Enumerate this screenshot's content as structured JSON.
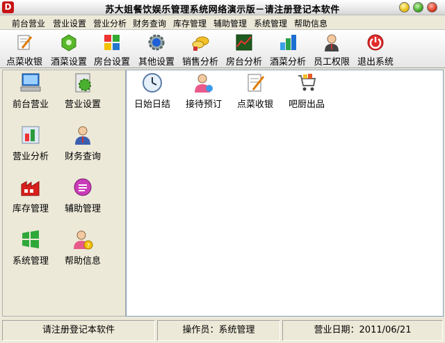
{
  "window": {
    "title": "苏大姐餐饮娱乐管理系统网络演示版－请注册登记本软件",
    "app_icon_glyph": "D"
  },
  "menu": [
    "前台营业",
    "营业设置",
    "营业分析",
    "财务查询",
    "库存管理",
    "辅助管理",
    "系统管理",
    "帮助信息"
  ],
  "toolbar": [
    {
      "label": "点菜收银",
      "icon": "order-icon"
    },
    {
      "label": "酒菜设置",
      "icon": "dish-settings-icon"
    },
    {
      "label": "房台设置",
      "icon": "table-settings-icon"
    },
    {
      "label": "其他设置",
      "icon": "other-settings-icon"
    },
    {
      "label": "销售分析",
      "icon": "sales-analysis-icon"
    },
    {
      "label": "房台分析",
      "icon": "table-analysis-icon"
    },
    {
      "label": "酒菜分析",
      "icon": "dish-analysis-icon"
    },
    {
      "label": "员工权限",
      "icon": "staff-permission-icon"
    },
    {
      "label": "退出系统",
      "icon": "exit-icon"
    }
  ],
  "sidebar": [
    {
      "label": "前台营业",
      "icon": "front-desk-icon"
    },
    {
      "label": "营业设置",
      "icon": "business-settings-icon"
    },
    {
      "label": "营业分析",
      "icon": "business-analysis-icon"
    },
    {
      "label": "财务查询",
      "icon": "finance-query-icon"
    },
    {
      "label": "库存管理",
      "icon": "inventory-icon"
    },
    {
      "label": "辅助管理",
      "icon": "auxiliary-icon"
    },
    {
      "label": "系统管理",
      "icon": "system-icon"
    },
    {
      "label": "帮助信息",
      "icon": "help-icon"
    }
  ],
  "main_items": [
    {
      "label": "日始日结",
      "icon": "clock-icon"
    },
    {
      "label": "接待预订",
      "icon": "reception-icon"
    },
    {
      "label": "点菜收银",
      "icon": "order-icon"
    },
    {
      "label": "吧厨出品",
      "icon": "kitchen-cart-icon"
    }
  ],
  "status": {
    "register": "请注册登记本软件",
    "operator": "操作员：系统管理",
    "date": "营业日期：2011/06/21"
  },
  "colors": {
    "title_red": "#c81414",
    "panel": "#ece9d8",
    "main_bg": "#ffffff"
  }
}
